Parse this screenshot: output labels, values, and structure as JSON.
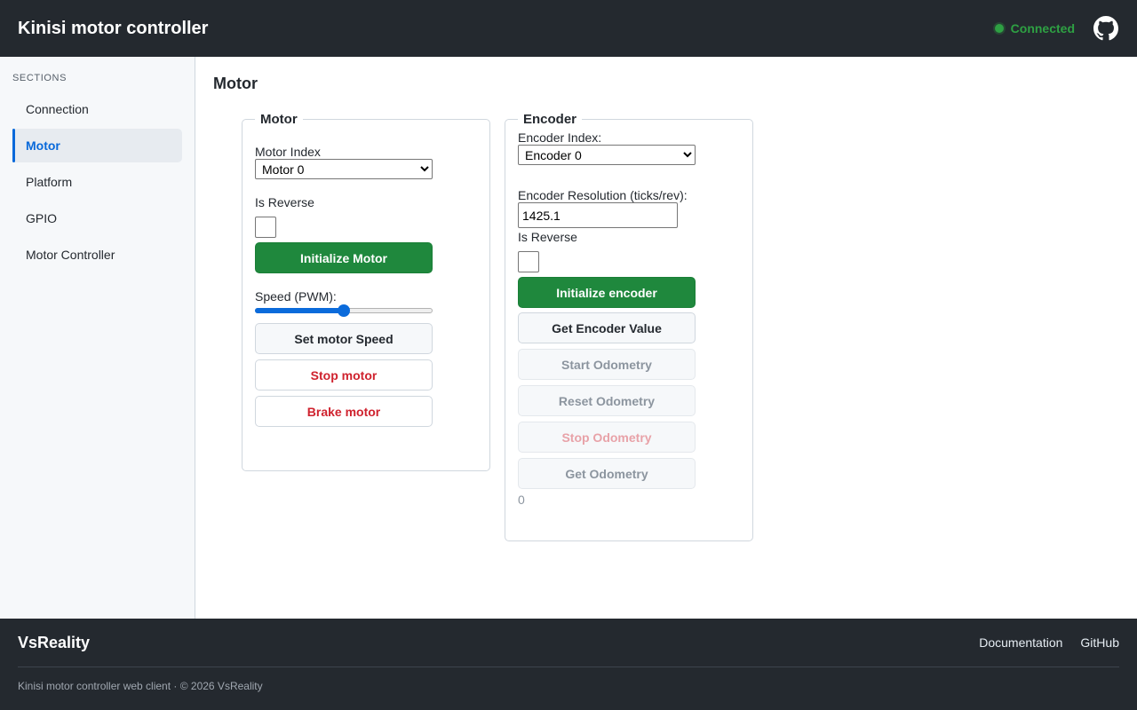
{
  "header": {
    "title": "Kinisi motor controller",
    "status_label": "Connected",
    "status_color": "#2ea043",
    "github_icon": "github-icon"
  },
  "sidebar": {
    "heading": "SECTIONS",
    "items": [
      {
        "label": "Connection",
        "active": false
      },
      {
        "label": "Motor",
        "active": true
      },
      {
        "label": "Platform",
        "active": false
      },
      {
        "label": "GPIO",
        "active": false
      },
      {
        "label": "Motor Controller",
        "active": false
      }
    ]
  },
  "main": {
    "title": "Motor",
    "motor": {
      "legend": "Motor",
      "index_label": "Motor Index",
      "index_value": "Motor 0",
      "reverse_label": "Is Reverse",
      "reverse_checked": false,
      "init_label": "Initialize Motor",
      "speed_label": "Speed (PWM):",
      "speed_fraction": 0.5,
      "set_speed_label": "Set motor Speed",
      "stop_label": "Stop motor",
      "brake_label": "Brake motor"
    },
    "encoder": {
      "legend": "Encoder",
      "index_label": "Encoder Index:",
      "index_value": "Encoder 0",
      "resolution_label": "Encoder Resolution (ticks/rev):",
      "resolution_value": "1425.1",
      "reverse_label": "Is Reverse",
      "reverse_checked": false,
      "init_label": "Initialize encoder",
      "get_value_label": "Get Encoder Value",
      "start_odometry_label": "Start Odometry",
      "reset_odometry_label": "Reset Odometry",
      "stop_odometry_label": "Stop Odometry",
      "get_odometry_label": "Get Odometry",
      "odometry_value": "0"
    }
  },
  "footer": {
    "brand": "VsReality",
    "links": [
      "Documentation",
      "GitHub"
    ],
    "copyright": "Kinisi motor controller web client · © 2026 VsReality"
  },
  "colors": {
    "header_bg": "#24292f",
    "accent": "#0969da",
    "primary_button": "#1f883d",
    "danger_text": "#cf222e"
  }
}
